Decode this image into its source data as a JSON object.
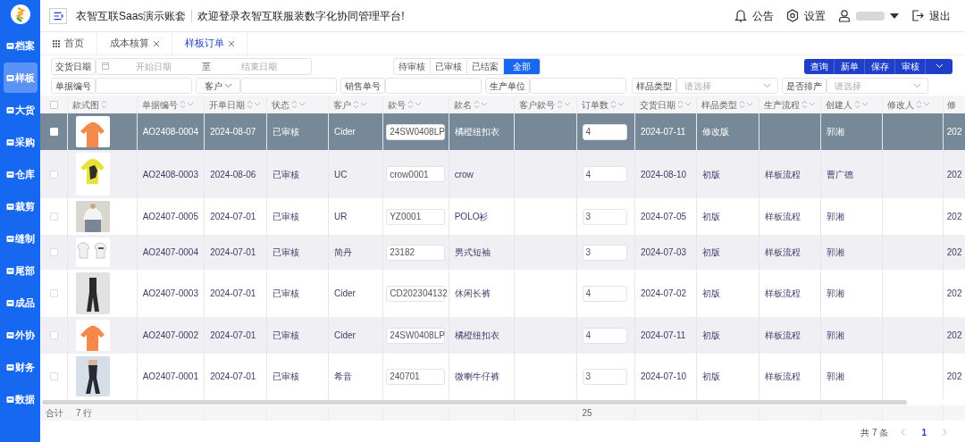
{
  "header": {
    "title": "衣智互联Saas演示账套",
    "welcome": "欢迎登录衣智互联服装数字化协同管理平台!",
    "actions": [
      {
        "kind": "notice",
        "label": "公告"
      },
      {
        "kind": "settings",
        "label": "设置"
      },
      {
        "kind": "user"
      },
      {
        "kind": "logout",
        "label": "退出"
      }
    ]
  },
  "sidebar": {
    "items": [
      {
        "label": "档案",
        "selected": false
      },
      {
        "label": "样板",
        "selected": true
      },
      {
        "label": "大货",
        "selected": false
      },
      {
        "label": "采购",
        "selected": false
      },
      {
        "label": "仓库",
        "selected": false
      },
      {
        "label": "裁剪",
        "selected": false
      },
      {
        "label": "缝制",
        "selected": false
      },
      {
        "label": "尾部",
        "selected": false
      },
      {
        "label": "成品",
        "selected": false
      },
      {
        "label": "外协",
        "selected": false
      },
      {
        "label": "财务",
        "selected": false
      },
      {
        "label": "数据",
        "selected": false
      }
    ]
  },
  "tabs": [
    {
      "label": "首页",
      "selected": false,
      "closable": false
    },
    {
      "label": "成本核算",
      "selected": false,
      "closable": true
    },
    {
      "label": "样板订单",
      "selected": true,
      "closable": true
    }
  ],
  "date_filter": {
    "label": "交货日期",
    "start_placeholder": "开始日期",
    "separator": "至",
    "end_placeholder": "结束日期"
  },
  "status_tabs": [
    {
      "label": "待审核",
      "selected": false
    },
    {
      "label": "已审核",
      "selected": false
    },
    {
      "label": "已结案",
      "selected": false
    },
    {
      "label": "全部",
      "selected": true
    }
  ],
  "action_buttons": [
    {
      "label": "查询"
    },
    {
      "label": "新单"
    },
    {
      "label": "保存"
    },
    {
      "label": "审核"
    }
  ],
  "filters": [
    {
      "kind": "text",
      "label": "单据编号"
    },
    {
      "kind": "text",
      "label": "客户",
      "dropdown": true
    },
    {
      "kind": "text",
      "label": "销售单号"
    },
    {
      "kind": "text",
      "label": "生产单位"
    },
    {
      "kind": "select",
      "label": "样品类型",
      "placeholder": "请选择"
    },
    {
      "kind": "select",
      "label": "是否排产",
      "placeholder": "请选择"
    }
  ],
  "table": {
    "columns": [
      {
        "label": "款式图",
        "filter": false
      },
      {
        "label": "单据编号",
        "filter": true
      },
      {
        "label": "开单日期",
        "filter": true
      },
      {
        "label": "状态",
        "filter": true
      },
      {
        "label": "客户",
        "filter": true
      },
      {
        "label": "款号",
        "filter": true
      },
      {
        "label": "款名",
        "filter": true
      },
      {
        "label": "客户款号",
        "filter": true
      },
      {
        "label": "订单数",
        "filter": true
      },
      {
        "label": "交货日期",
        "filter": true
      },
      {
        "label": "样品类型",
        "filter": true
      },
      {
        "label": "生产流程",
        "filter": true
      },
      {
        "label": "创建人",
        "filter": true
      },
      {
        "label": "修改人",
        "filter": true
      },
      {
        "label": "修"
      }
    ],
    "select_all": {
      "checked": false
    },
    "rows": [
      {
        "selected": true,
        "checked": false,
        "doc_no": "AO2408-0004",
        "open_date": "2024-08-07",
        "status": "已审核",
        "customer": "Cider",
        "style_no": "24SW0408LP",
        "style_name": "橘橙纽扣衣",
        "quantity": "4",
        "delivery_date": "2024-07-11",
        "sample_type": "修改版",
        "creator": "郭湘",
        "modified": "202"
      },
      {
        "selected": false,
        "checked": false,
        "doc_no": "AO2408-0003",
        "open_date": "2024-08-06",
        "status": "已审核",
        "customer": "UC",
        "style_no": "crow0001",
        "style_name": "crow",
        "quantity": "4",
        "delivery_date": "2024-08-10",
        "sample_type": "初版",
        "process": "样板流程",
        "creator": "曹广德",
        "modified": "202"
      },
      {
        "selected": false,
        "checked": false,
        "doc_no": "AO2407-0005",
        "open_date": "2024-07-01",
        "status": "已审核",
        "customer": "UR",
        "style_no": "YZ0001",
        "style_name": "POLO衫",
        "quantity": "3",
        "delivery_date": "2024-07-05",
        "sample_type": "初版",
        "process": "样板流程",
        "creator": "郭湘",
        "modified": "202"
      },
      {
        "selected": false,
        "checked": false,
        "doc_no": "AO2407-0004",
        "open_date": "2024-07-01",
        "status": "已审核",
        "customer": "简丹",
        "style_no": "23182",
        "style_name": "男式短袖",
        "quantity": "3",
        "delivery_date": "2024-07-03",
        "sample_type": "初版",
        "process": "样板流程",
        "creator": "郭湘",
        "modified": "202"
      },
      {
        "selected": false,
        "checked": false,
        "doc_no": "AO2407-0003",
        "open_date": "2024-07-01",
        "status": "已审核",
        "customer": "Cider",
        "style_no": "CD202304132",
        "style_name": "休闲长裤",
        "quantity": "4",
        "delivery_date": "2024-07-02",
        "sample_type": "初版",
        "process": "样板流程",
        "creator": "郭湘",
        "modified": "202"
      },
      {
        "selected": false,
        "checked": false,
        "doc_no": "AO2407-0002",
        "open_date": "2024-07-01",
        "status": "已审核",
        "customer": "Cider",
        "style_no": "24SW0408LP",
        "style_name": "橘橙纽扣衣",
        "quantity": "4",
        "delivery_date": "2024-07-11",
        "sample_type": "初版",
        "process": "样板流程",
        "creator": "郭湘",
        "modified": "202"
      },
      {
        "selected": false,
        "checked": false,
        "doc_no": "AO2407-0001",
        "open_date": "2024-07-01",
        "status": "已审核",
        "customer": "希音",
        "style_no": "240701",
        "style_name": "微喇牛仔裤",
        "quantity": "3",
        "delivery_date": "2024-07-10",
        "sample_type": "初版",
        "process": "样板流程",
        "creator": "郭湘",
        "modified": "202"
      }
    ],
    "footer": {
      "total_label": "合计",
      "row_count": "7 行",
      "quantity_total": "25"
    }
  },
  "pagination": {
    "total": "共 7 条",
    "pages": [
      {
        "label": "1",
        "selected": true
      }
    ]
  }
}
